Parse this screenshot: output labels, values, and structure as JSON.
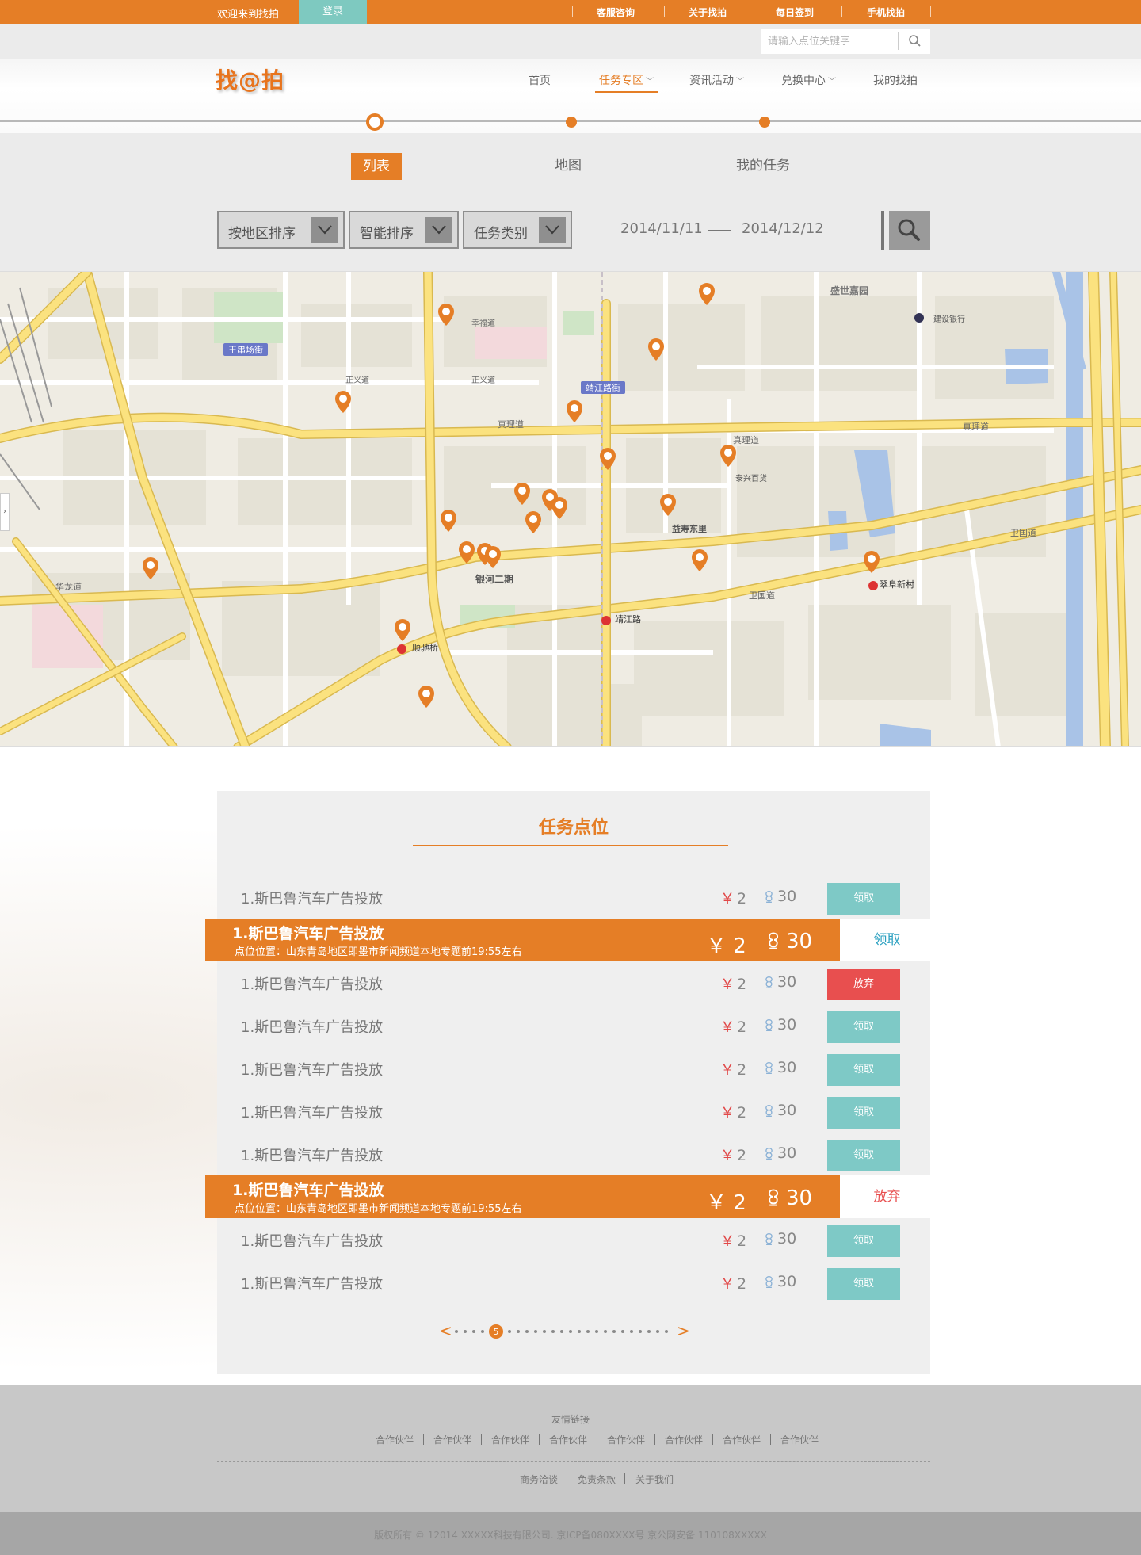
{
  "topbar": {
    "welcome": "欢迎来到找拍",
    "login": "登录",
    "links": [
      "客服咨询",
      "关于找拍",
      "每日签到",
      "手机找拍"
    ]
  },
  "search": {
    "placeholder": "请输入点位关键字"
  },
  "header": {
    "logo": "找@拍",
    "nav": [
      {
        "label": "首页",
        "dropdown": false
      },
      {
        "label": "任务专区",
        "dropdown": true,
        "active": true
      },
      {
        "label": "资讯活动",
        "dropdown": true
      },
      {
        "label": "兑换中心",
        "dropdown": true
      },
      {
        "label": "我的找拍",
        "dropdown": false
      }
    ]
  },
  "tabs": {
    "list": "列表",
    "map": "地图",
    "mine": "我的任务"
  },
  "filters": {
    "region": "按地区排序",
    "smart": "智能排序",
    "category": "任务类别",
    "date_from": "2014/11/11",
    "date_to": "2014/12/12"
  },
  "map": {
    "labels": {
      "wangchuanchang": "王串场街",
      "jingjianglu": "靖江路街",
      "shengshijiayuan": "盛世嘉园",
      "zhenli": "真理道",
      "jingjianglu2": "靖江路",
      "shunchiqiao": "顺驰桥",
      "cuifuxincun": "翠阜新村",
      "weiguodao": "卫国道",
      "hualongdao": "华龙道",
      "ziyoudao": "正义道",
      "xingfudao": "幸福道",
      "jianshedao": "建设银行",
      "taixingbaihuo": "泰兴百货",
      "yishoudongli": "益寿东里",
      "yinheguoji": "银河二期"
    }
  },
  "panel": {
    "title": "任务点位",
    "rows": [
      {
        "type": "row",
        "name": "1.斯巴鲁汽车广告投放",
        "yen_symbol": "￥",
        "yen": "2",
        "points": "30",
        "button": "领取",
        "action": "get"
      },
      {
        "type": "hl",
        "name": "1.斯巴鲁汽车广告投放",
        "desc": "点位位置：山东青岛地区即墨市新闻频道本地专题前19:55左右",
        "yen_symbol": "￥",
        "yen": "2",
        "points": "30",
        "button": "领取",
        "action": "get"
      },
      {
        "type": "row",
        "name": "1.斯巴鲁汽车广告投放",
        "yen_symbol": "￥",
        "yen": "2",
        "points": "30",
        "button": "放弃",
        "action": "drop"
      },
      {
        "type": "row",
        "name": "1.斯巴鲁汽车广告投放",
        "yen_symbol": "￥",
        "yen": "2",
        "points": "30",
        "button": "领取",
        "action": "get"
      },
      {
        "type": "row",
        "name": "1.斯巴鲁汽车广告投放",
        "yen_symbol": "￥",
        "yen": "2",
        "points": "30",
        "button": "领取",
        "action": "get"
      },
      {
        "type": "row",
        "name": "1.斯巴鲁汽车广告投放",
        "yen_symbol": "￥",
        "yen": "2",
        "points": "30",
        "button": "领取",
        "action": "get"
      },
      {
        "type": "row",
        "name": "1.斯巴鲁汽车广告投放",
        "yen_symbol": "￥",
        "yen": "2",
        "points": "30",
        "button": "领取",
        "action": "get"
      },
      {
        "type": "hl",
        "name": "1.斯巴鲁汽车广告投放",
        "desc": "点位位置：山东青岛地区即墨市新闻频道本地专题前19:55左右",
        "yen_symbol": "￥",
        "yen": "2",
        "points": "30",
        "button": "放弃",
        "action": "drop"
      },
      {
        "type": "row",
        "name": "1.斯巴鲁汽车广告投放",
        "yen_symbol": "￥",
        "yen": "2",
        "points": "30",
        "button": "领取",
        "action": "get"
      },
      {
        "type": "row",
        "name": "1.斯巴鲁汽车广告投放",
        "yen_symbol": "￥",
        "yen": "2",
        "points": "30",
        "button": "领取",
        "action": "get"
      }
    ],
    "pager": {
      "prev": "<",
      "next": ">",
      "current": "5",
      "current_index": 4,
      "total_dots": 24
    }
  },
  "footer": {
    "friend_title": "友情链接",
    "friend_links": [
      "合作伙伴",
      "合作伙伴",
      "合作伙伴",
      "合作伙伴",
      "合作伙伴",
      "合作伙伴",
      "合作伙伴",
      "合作伙伴"
    ],
    "bottom_links": [
      "商务洽谈",
      "免责条款",
      "关于我们"
    ],
    "copyright": "版权所有 © 12014 XXXXX科技有限公司. 京ICP备080XXXX号 京公网安备 110108XXXXX"
  },
  "colors": {
    "accent": "#e57e26",
    "teal": "#7ec9c6",
    "danger": "#e84f4f"
  }
}
